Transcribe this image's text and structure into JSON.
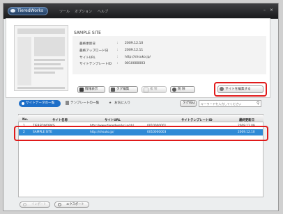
{
  "app": {
    "logo_text": "TieredWorks"
  },
  "menu": [
    "ツール",
    "オプション",
    "ヘルプ"
  ],
  "window_controls": [
    "–",
    "×"
  ],
  "site": {
    "title": "SAMPLE SITE",
    "info": [
      {
        "label": "最終更新日",
        "value": "2009.12.10"
      },
      {
        "label": "最終アップロード日",
        "value": "2009.12.11"
      },
      {
        "label": "サイトURL",
        "value": "http://shsuko.jp/"
      },
      {
        "label": "サイトテンプレートID",
        "value": "0010000003"
      }
    ]
  },
  "actions": {
    "info": "情報表示",
    "tag_edit": "タグ編集",
    "copy": "複 製",
    "delete": "削 除",
    "edit_site": "サイトを編集する"
  },
  "tabs": {
    "site_list": "サイトデータの一覧",
    "template_list": "テンプレートの一覧",
    "favorites": "お気に入り"
  },
  "search": {
    "label": "タグ絞込",
    "placeholder": "キーワードを入力してください"
  },
  "table": {
    "columns": [
      "No.",
      "サイト名称",
      "サイトURL",
      "サイトテンプレートID",
      "最終更新日"
    ],
    "rows": [
      [
        "1",
        "TIEREDWORKS",
        "http://www.tieredworks.jp/sh/...",
        "0010000001",
        "2009.12.09"
      ],
      [
        "2",
        "SAMPLE SITE",
        "http://shsuko.jp/",
        "0010000003",
        "2009.12.10"
      ]
    ],
    "selected_row": 1
  },
  "footer": {
    "import": "インポート",
    "export": "エクスポート"
  },
  "colors": {
    "accent": "#1e6fc8",
    "selected_row": "#2f8ad6",
    "highlight": "#e01a1a"
  }
}
